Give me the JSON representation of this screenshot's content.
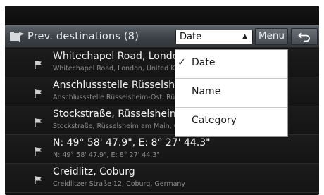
{
  "header": {
    "title": "Prev. destinations (8)",
    "sort_value": "Date",
    "menu_label": "Menu",
    "back_icon": "back-arrow-icon",
    "title_icon": "folder-flag-icon"
  },
  "destinations": [
    {
      "name": "Whitechapel Road, London",
      "address": "Whitechapel Road, London, United Kingdom",
      "icon": "flag-icon"
    },
    {
      "name": "Anschlussstelle Rüsselsheim-Ost, Rüss...",
      "address": "Anschlussstelle Rüsselsheim-Ost, Rüsselsheim a...",
      "icon": "flag-icon"
    },
    {
      "name": "Stockstraße, Rüsselsheim",
      "address": "Stockstraße, Rüsselsheim am Main, Germany",
      "icon": "flag-icon"
    },
    {
      "name": "N: 49° 58' 47.9\", E: 8° 27' 44.3\"",
      "address": "N: 49° 58' 47.9\", E: 8° 27' 44.3\"",
      "icon": "flag-icon"
    },
    {
      "name": "Creidlitz, Coburg",
      "address": "Creidlitzer Straße 12, Coburg, Germany",
      "icon": "flag-icon"
    }
  ],
  "sort_menu": {
    "options": [
      {
        "label": "Date",
        "checked": true
      },
      {
        "label": "Name",
        "checked": false
      },
      {
        "label": "Category",
        "checked": false
      }
    ],
    "check_glyph": "✓"
  }
}
